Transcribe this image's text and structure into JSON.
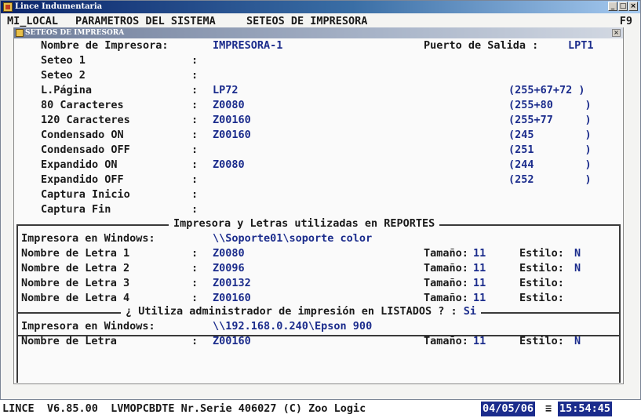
{
  "window": {
    "title": "Lince Indumentaria",
    "buttons": {
      "minimize": "_",
      "maximize": "□",
      "close": "×"
    }
  },
  "menubar": {
    "items": [
      "MI_LOCAL",
      "PARAMETROS DEL SISTEMA",
      "SETEOS DE IMPRESORA"
    ],
    "function_key": "F9"
  },
  "panel": {
    "title": "SETEOS DE IMPRESORA",
    "close": "×"
  },
  "printer": {
    "name_label": "Nombre de Impresora:",
    "name_value": "IMPRESORA-1",
    "port_label": "Puerto de Salida :",
    "port_value": "LPT1"
  },
  "settings": [
    {
      "label": "Seteo 1",
      "sep": ":",
      "value": "",
      "code": ""
    },
    {
      "label": "Seteo 2",
      "sep": ":",
      "value": "",
      "code": ""
    },
    {
      "label": "L.Página",
      "sep": ":",
      "value": "LP72",
      "code": "(255+67+72 )"
    },
    {
      "label": "80 Caracteres",
      "sep": ":",
      "value": "Z0080",
      "code": "(255+80     )"
    },
    {
      "label": "120 Caracteres",
      "sep": ":",
      "value": "Z00160",
      "code": "(255+77     )"
    },
    {
      "label": "Condensado ON",
      "sep": ":",
      "value": "Z00160",
      "code": "(245        )"
    },
    {
      "label": "Condensado OFF",
      "sep": ":",
      "value": "",
      "code": "(251        )"
    },
    {
      "label": "Expandido ON",
      "sep": ":",
      "value": "Z0080",
      "code": "(244        )"
    },
    {
      "label": "Expandido OFF",
      "sep": ":",
      "value": "",
      "code": "(252        )"
    },
    {
      "label": "Captura Inicio",
      "sep": ":",
      "value": "",
      "code": ""
    },
    {
      "label": "Captura Fin",
      "sep": ":",
      "value": "",
      "code": ""
    }
  ],
  "reports": {
    "title": "Impresora y Letras utilizadas en REPORTES",
    "windows_label": "Impresora en Windows:",
    "windows_value": "\\\\Soporte01\\soporte color",
    "fonts": [
      {
        "label": "Nombre de Letra 1",
        "sep": ":",
        "value": "Z0080",
        "size_label": "Tamaño:",
        "size": "11",
        "style_label": "Estilo:",
        "style": "N"
      },
      {
        "label": "Nombre de Letra 2",
        "sep": ":",
        "value": "Z0096",
        "size_label": "Tamaño:",
        "size": "11",
        "style_label": "Estilo:",
        "style": "N"
      },
      {
        "label": "Nombre de Letra 3",
        "sep": ":",
        "value": "Z00132",
        "size_label": "Tamaño:",
        "size": "11",
        "style_label": "Estilo:",
        "style": ""
      },
      {
        "label": "Nombre de Letra 4",
        "sep": ":",
        "value": "Z00160",
        "size_label": "Tamaño:",
        "size": "11",
        "style_label": "Estilo:",
        "style": ""
      }
    ]
  },
  "listados": {
    "question": "¿ Utiliza administrador de impresión en LISTADOS ? :",
    "answer": "Si",
    "windows_label": "Impresora en Windows:",
    "windows_value": "\\\\192.168.0.240\\Epson 900",
    "font_label": "Nombre de Letra",
    "font_sep": ":",
    "font_value": "Z00160",
    "size_label": "Tamaño:",
    "size": "11",
    "style_label": "Estilo:",
    "style": "N"
  },
  "status": {
    "text": "LINCE  V6.85.00  LVMOPCBDTE Nr.Serie 406027 (C) Zoo Logic",
    "date": "04/05/06",
    "separator": "≡",
    "time": "15:54:45"
  },
  "colors": {
    "value_blue": "#1b2c8c",
    "titlebar": "#0a246a"
  }
}
